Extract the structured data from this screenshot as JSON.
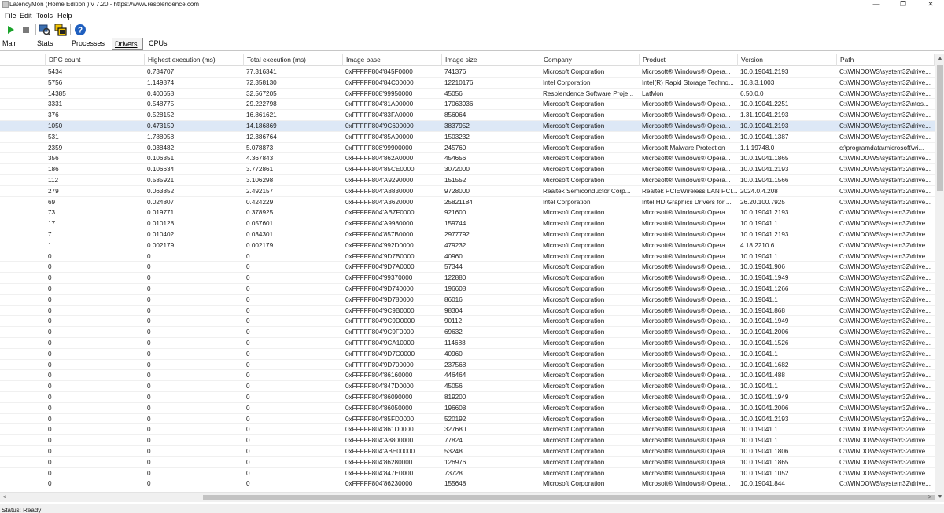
{
  "window": {
    "title": "LatencyMon  (Home Edition )  v 7.20 - https://www.resplendence.com",
    "minimize_glyph": "—",
    "maximize_glyph": "❐",
    "close_glyph": "✕"
  },
  "menu": [
    "File",
    "Edit",
    "Tools",
    "Help"
  ],
  "toolbar": [
    {
      "name": "play-icon"
    },
    {
      "name": "stop-icon"
    },
    {
      "name": "analyze-icon"
    },
    {
      "name": "windows-icon"
    },
    {
      "name": "help-icon"
    }
  ],
  "tabs": [
    {
      "label": "Main",
      "active": false
    },
    {
      "label": "Stats",
      "active": false
    },
    {
      "label": "Processes",
      "active": false
    },
    {
      "label": "Drivers",
      "active": true
    },
    {
      "label": "CPUs",
      "active": false
    }
  ],
  "columns": [
    "DPC count",
    "Highest execution (ms)",
    "Total execution (ms)",
    "Image base",
    "Image size",
    "Company",
    "Product",
    "Version",
    "Path"
  ],
  "selected_row": 5,
  "rows": [
    [
      "5434",
      "0.734707",
      "77.316341",
      "0xFFFFF804'845F0000",
      "741376",
      "Microsoft Corporation",
      "Microsoft® Windows® Opera...",
      "10.0.19041.2193",
      "C:\\WINDOWS\\system32\\drive..."
    ],
    [
      "5756",
      "1.149874",
      "72.358130",
      "0xFFFFF804'84C00000",
      "12210176",
      "Intel Corporation",
      "Intel(R) Rapid Storage Techno...",
      "16.8.3.1003",
      "C:\\WINDOWS\\system32\\drive..."
    ],
    [
      "14385",
      "0.400658",
      "32.567205",
      "0xFFFFF808'99950000",
      "45056",
      "Resplendence Software Proje...",
      "LatMon",
      "6.50.0.0",
      "C:\\WINDOWS\\system32\\drive..."
    ],
    [
      "3331",
      "0.548775",
      "29.222798",
      "0xFFFFF804'81A00000",
      "17063936",
      "Microsoft Corporation",
      "Microsoft® Windows® Opera...",
      "10.0.19041.2251",
      "C:\\WINDOWS\\system32\\ntos..."
    ],
    [
      "376",
      "0.528152",
      "16.861621",
      "0xFFFFF804'83FA0000",
      "856064",
      "Microsoft Corporation",
      "Microsoft® Windows® Opera...",
      "1.31.19041.2193",
      "C:\\WINDOWS\\system32\\drive..."
    ],
    [
      "1050",
      "0.473159",
      "14.186869",
      "0xFFFFF804'9C600000",
      "3837952",
      "Microsoft Corporation",
      "Microsoft® Windows® Opera...",
      "10.0.19041.2193",
      "C:\\WINDOWS\\system32\\drive..."
    ],
    [
      "531",
      "1.788058",
      "12.386764",
      "0xFFFFF804'85A90000",
      "1503232",
      "Microsoft Corporation",
      "Microsoft® Windows® Opera...",
      "10.0.19041.1387",
      "C:\\WINDOWS\\system32\\drive..."
    ],
    [
      "2359",
      "0.038482",
      "5.078873",
      "0xFFFFF808'99900000",
      "245760",
      "Microsoft Corporation",
      "Microsoft Malware Protection",
      "1.1.19748.0",
      "c:\\programdata\\microsoft\\wi..."
    ],
    [
      "356",
      "0.106351",
      "4.367843",
      "0xFFFFF804'862A0000",
      "454656",
      "Microsoft Corporation",
      "Microsoft® Windows® Opera...",
      "10.0.19041.1865",
      "C:\\WINDOWS\\system32\\drive..."
    ],
    [
      "186",
      "0.106634",
      "3.772861",
      "0xFFFFF804'85CE0000",
      "3072000",
      "Microsoft Corporation",
      "Microsoft® Windows® Opera...",
      "10.0.19041.2193",
      "C:\\WINDOWS\\system32\\drive..."
    ],
    [
      "112",
      "0.585921",
      "3.106298",
      "0xFFFFF804'A9290000",
      "151552",
      "Microsoft Corporation",
      "Microsoft® Windows® Opera...",
      "10.0.19041.1566",
      "C:\\WINDOWS\\system32\\drive..."
    ],
    [
      "279",
      "0.063852",
      "2.492157",
      "0xFFFFF804'A8830000",
      "9728000",
      "Realtek Semiconductor Corp...",
      "Realtek  PCIEWireless LAN PCI...",
      "2024.0.4.208",
      "C:\\WINDOWS\\system32\\drive..."
    ],
    [
      "69",
      "0.024807",
      "0.424229",
      "0xFFFFF804'A3620000",
      "25821184",
      "Intel Corporation",
      "Intel HD Graphics Drivers for ...",
      "26.20.100.7925",
      "C:\\WINDOWS\\system32\\drive..."
    ],
    [
      "73",
      "0.019771",
      "0.378925",
      "0xFFFFF804'AB7F0000",
      "921600",
      "Microsoft Corporation",
      "Microsoft® Windows® Opera...",
      "10.0.19041.2193",
      "C:\\WINDOWS\\system32\\drive..."
    ],
    [
      "17",
      "0.010128",
      "0.057601",
      "0xFFFFF804'A9980000",
      "159744",
      "Microsoft Corporation",
      "Microsoft® Windows® Opera...",
      "10.0.19041.1",
      "C:\\WINDOWS\\system32\\drive..."
    ],
    [
      "7",
      "0.010402",
      "0.034301",
      "0xFFFFF804'857B0000",
      "2977792",
      "Microsoft Corporation",
      "Microsoft® Windows® Opera...",
      "10.0.19041.2193",
      "C:\\WINDOWS\\system32\\drive..."
    ],
    [
      "1",
      "0.002179",
      "0.002179",
      "0xFFFFF804'992D0000",
      "479232",
      "Microsoft Corporation",
      "Microsoft® Windows® Opera...",
      "4.18.2210.6",
      "C:\\WINDOWS\\system32\\drive..."
    ],
    [
      "0",
      "0",
      "0",
      "0xFFFFF804'9D7B0000",
      "40960",
      "Microsoft Corporation",
      "Microsoft® Windows® Opera...",
      "10.0.19041.1",
      "C:\\WINDOWS\\system32\\drive..."
    ],
    [
      "0",
      "0",
      "0",
      "0xFFFFF804'9D7A0000",
      "57344",
      "Microsoft Corporation",
      "Microsoft® Windows® Opera...",
      "10.0.19041.906",
      "C:\\WINDOWS\\system32\\drive..."
    ],
    [
      "0",
      "0",
      "0",
      "0xFFFFF804'99370000",
      "122880",
      "Microsoft Corporation",
      "Microsoft® Windows® Opera...",
      "10.0.19041.1949",
      "C:\\WINDOWS\\system32\\drive..."
    ],
    [
      "0",
      "0",
      "0",
      "0xFFFFF804'9D740000",
      "196608",
      "Microsoft Corporation",
      "Microsoft® Windows® Opera...",
      "10.0.19041.1266",
      "C:\\WINDOWS\\system32\\drive..."
    ],
    [
      "0",
      "0",
      "0",
      "0xFFFFF804'9D780000",
      "86016",
      "Microsoft Corporation",
      "Microsoft® Windows® Opera...",
      "10.0.19041.1",
      "C:\\WINDOWS\\system32\\drive..."
    ],
    [
      "0",
      "0",
      "0",
      "0xFFFFF804'9C9B0000",
      "98304",
      "Microsoft Corporation",
      "Microsoft® Windows® Opera...",
      "10.0.19041.868",
      "C:\\WINDOWS\\system32\\drive..."
    ],
    [
      "0",
      "0",
      "0",
      "0xFFFFF804'9C9D0000",
      "90112",
      "Microsoft Corporation",
      "Microsoft® Windows® Opera...",
      "10.0.19041.1949",
      "C:\\WINDOWS\\system32\\drive..."
    ],
    [
      "0",
      "0",
      "0",
      "0xFFFFF804'9C9F0000",
      "69632",
      "Microsoft Corporation",
      "Microsoft® Windows® Opera...",
      "10.0.19041.2006",
      "C:\\WINDOWS\\system32\\drive..."
    ],
    [
      "0",
      "0",
      "0",
      "0xFFFFF804'9CA10000",
      "114688",
      "Microsoft Corporation",
      "Microsoft® Windows® Opera...",
      "10.0.19041.1526",
      "C:\\WINDOWS\\system32\\drive..."
    ],
    [
      "0",
      "0",
      "0",
      "0xFFFFF804'9D7C0000",
      "40960",
      "Microsoft Corporation",
      "Microsoft® Windows® Opera...",
      "10.0.19041.1",
      "C:\\WINDOWS\\system32\\drive..."
    ],
    [
      "0",
      "0",
      "0",
      "0xFFFFF804'9D700000",
      "237568",
      "Microsoft Corporation",
      "Microsoft® Windows® Opera...",
      "10.0.19041.1682",
      "C:\\WINDOWS\\system32\\drive..."
    ],
    [
      "0",
      "0",
      "0",
      "0xFFFFF804'86160000",
      "446464",
      "Microsoft Corporation",
      "Microsoft® Windows® Opera...",
      "10.0.19041.488",
      "C:\\WINDOWS\\system32\\drive..."
    ],
    [
      "0",
      "0",
      "0",
      "0xFFFFF804'847D0000",
      "45056",
      "Microsoft Corporation",
      "Microsoft® Windows® Opera...",
      "10.0.19041.1",
      "C:\\WINDOWS\\system32\\drive..."
    ],
    [
      "0",
      "0",
      "0",
      "0xFFFFF804'86090000",
      "819200",
      "Microsoft Corporation",
      "Microsoft® Windows® Opera...",
      "10.0.19041.1949",
      "C:\\WINDOWS\\system32\\drive..."
    ],
    [
      "0",
      "0",
      "0",
      "0xFFFFF804'86050000",
      "196608",
      "Microsoft Corporation",
      "Microsoft® Windows® Opera...",
      "10.0.19041.2006",
      "C:\\WINDOWS\\system32\\drive..."
    ],
    [
      "0",
      "0",
      "0",
      "0xFFFFF804'85FD0000",
      "520192",
      "Microsoft Corporation",
      "Microsoft® Windows® Opera...",
      "10.0.19041.2193",
      "C:\\WINDOWS\\system32\\drive..."
    ],
    [
      "0",
      "0",
      "0",
      "0xFFFFF804'861D0000",
      "327680",
      "Microsoft Corporation",
      "Microsoft® Windows® Opera...",
      "10.0.19041.1",
      "C:\\WINDOWS\\system32\\drive..."
    ],
    [
      "0",
      "0",
      "0",
      "0xFFFFF804'A8800000",
      "77824",
      "Microsoft Corporation",
      "Microsoft® Windows® Opera...",
      "10.0.19041.1",
      "C:\\WINDOWS\\system32\\drive..."
    ],
    [
      "0",
      "0",
      "0",
      "0xFFFFF804'ABE00000",
      "53248",
      "Microsoft Corporation",
      "Microsoft® Windows® Opera...",
      "10.0.19041.1806",
      "C:\\WINDOWS\\system32\\drive..."
    ],
    [
      "0",
      "0",
      "0",
      "0xFFFFF804'86280000",
      "126976",
      "Microsoft Corporation",
      "Microsoft® Windows® Opera...",
      "10.0.19041.1865",
      "C:\\WINDOWS\\system32\\drive..."
    ],
    [
      "0",
      "0",
      "0",
      "0xFFFFF804'847E0000",
      "73728",
      "Microsoft Corporation",
      "Microsoft® Windows® Opera...",
      "10.0.19041.1052",
      "C:\\WINDOWS\\system32\\drive..."
    ],
    [
      "0",
      "0",
      "0",
      "0xFFFFF804'86230000",
      "155648",
      "Microsoft Corporation",
      "Microsoft® Windows® Opera...",
      "10.0.19041.844",
      "C:\\WINDOWS\\system32\\drive..."
    ]
  ],
  "scroll": {
    "left_glyph": "<",
    "right_glyph": ">",
    "up_glyph": "▲",
    "down_glyph": "▼"
  },
  "status": {
    "text": "Status: Ready"
  },
  "colors": {
    "selected_row": "#dde8f6",
    "play": "#1aa32a",
    "help": "#1f5fbf"
  }
}
